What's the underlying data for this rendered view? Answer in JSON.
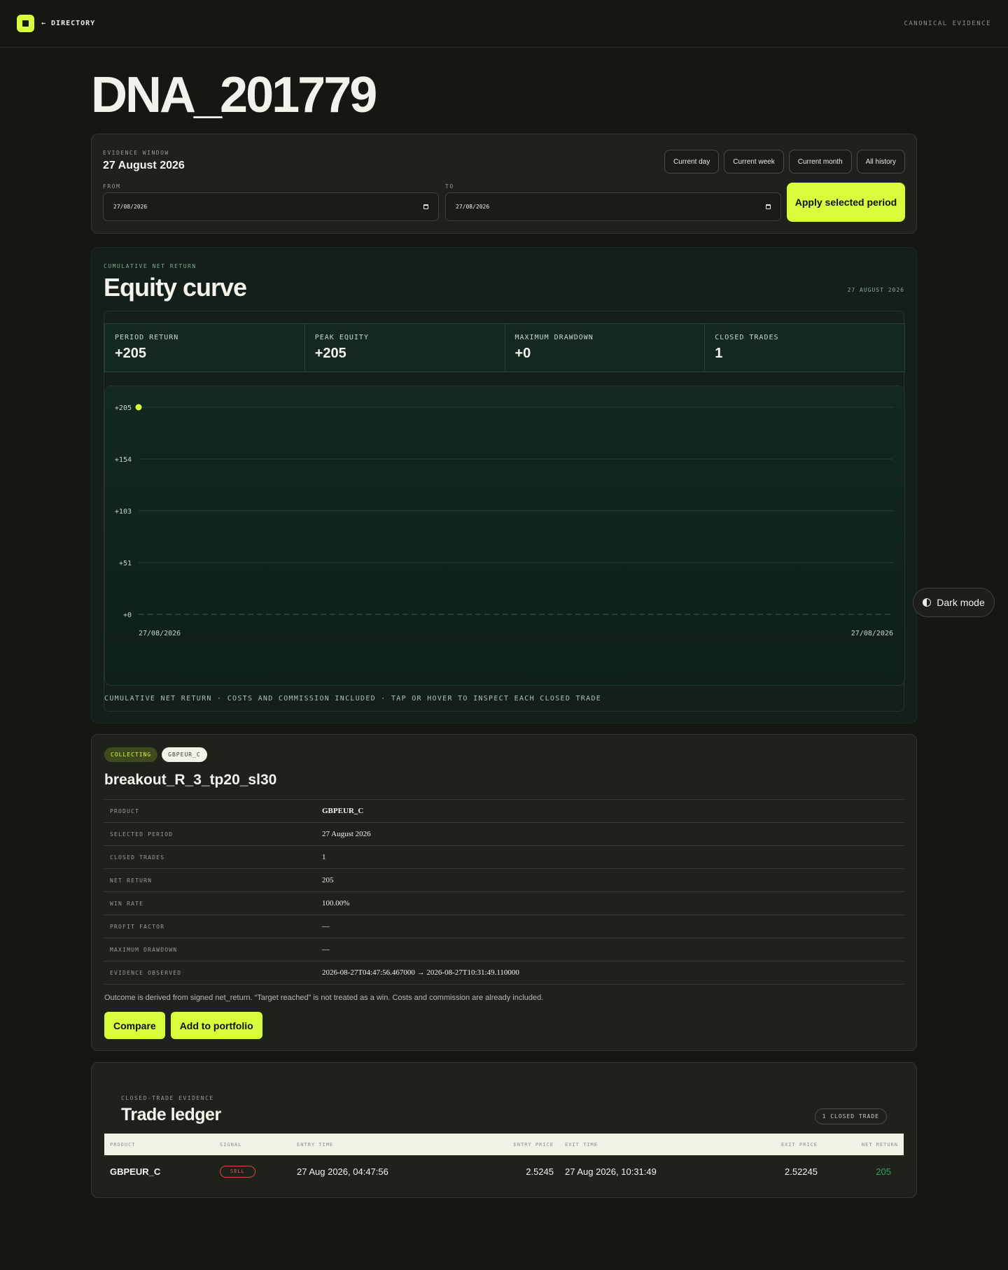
{
  "topbar": {
    "back_label": "← DIRECTORY",
    "right_label": "CANONICAL EVIDENCE"
  },
  "page": {
    "title": "DNA_201779"
  },
  "evidence_window": {
    "kicker": "EVIDENCE WINDOW",
    "date": "27 August 2026",
    "period_buttons": [
      "Current day",
      "Current week",
      "Current month",
      "All history"
    ],
    "from_label": "FROM",
    "from_value": "27/08/2026",
    "to_label": "TO",
    "to_value": "27/08/2026",
    "apply_label": "Apply selected period"
  },
  "equity": {
    "kicker": "CUMULATIVE NET RETURN",
    "title": "Equity curve",
    "date": "27 AUGUST 2026",
    "stats": [
      {
        "label": "PERIOD RETURN",
        "value": "+205"
      },
      {
        "label": "PEAK EQUITY",
        "value": "+205"
      },
      {
        "label": "MAXIMUM DRAWDOWN",
        "value": "+0"
      },
      {
        "label": "CLOSED TRADES",
        "value": "1"
      }
    ],
    "footnote": "CUMULATIVE NET RETURN · COSTS AND COMMISSION INCLUDED · TAP OR HOVER TO INSPECT EACH CLOSED TRADE"
  },
  "chart_data": {
    "type": "line",
    "y_ticks": [
      "+205",
      "+154",
      "+103",
      "+51",
      "+0"
    ],
    "ylim": [
      0,
      205
    ],
    "x_labels": [
      "27/08/2026",
      "27/08/2026"
    ],
    "points": [
      {
        "x": "27/08/2026",
        "y": 205
      }
    ],
    "baseline": 0,
    "grid": true,
    "accent_color": "#d8fb3b"
  },
  "strategy": {
    "status_badge": "COLLECTING",
    "product_badge": "GBPEUR_C",
    "title": "breakout_R_3_tp20_sl30",
    "details": [
      {
        "key": "PRODUCT",
        "value": "GBPEUR_C"
      },
      {
        "key": "SELECTED PERIOD",
        "value": "27 August 2026"
      },
      {
        "key": "CLOSED TRADES",
        "value": "1"
      },
      {
        "key": "NET RETURN",
        "value": "205"
      },
      {
        "key": "WIN RATE",
        "value": "100.00%"
      },
      {
        "key": "PROFIT FACTOR",
        "value": "—"
      },
      {
        "key": "MAXIMUM DRAWDOWN",
        "value": "—"
      },
      {
        "key": "EVIDENCE OBSERVED",
        "value": "2026-08-27T04:47:56.467000 → 2026-08-27T10:31:49.110000"
      }
    ],
    "note": "Outcome is derived from signed net_return. “Target reached” is not treated as a win. Costs and commission are already included.",
    "compare_label": "Compare",
    "portfolio_label": "Add to portfolio"
  },
  "ledger": {
    "kicker": "CLOSED-TRADE EVIDENCE",
    "title": "Trade ledger",
    "count": "1 CLOSED TRADE",
    "headers": [
      "PRODUCT",
      "SIGNAL",
      "ENTRY TIME",
      "ENTRY PRICE",
      "EXIT TIME",
      "EXIT PRICE",
      "NET RETURN"
    ],
    "rows": [
      {
        "product": "GBPEUR_C",
        "signal": "SELL",
        "entry_time": "27 Aug 2026, 04:47:56",
        "entry_price": "2.5245",
        "exit_time": "27 Aug 2026, 10:31:49",
        "exit_price": "2.52245",
        "net_return": "205"
      }
    ]
  },
  "theme_toggle": {
    "label": "Dark mode",
    "icon": "half-circle-icon"
  }
}
